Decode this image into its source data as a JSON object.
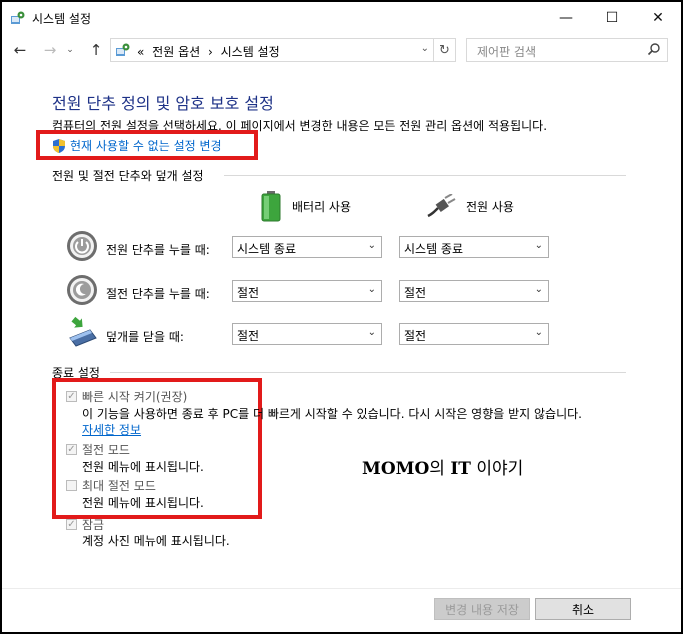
{
  "window": {
    "title": "시스템 설정",
    "icons": {
      "app": "control-panel-icon",
      "minimize": "minimize-icon",
      "maximize": "maximize-icon",
      "close": "close-icon"
    }
  },
  "nav": {
    "breadcrumb_prefix": "«",
    "breadcrumb_1": "전원 옵션",
    "breadcrumb_sep": "›",
    "breadcrumb_2": "시스템 설정",
    "search_placeholder": "제어판 검색"
  },
  "page": {
    "heading": "전원 단추 정의 및 암호 보호 설정",
    "description": "컴퓨터의 전원 설정을 선택하세요. 이 페이지에서 변경한 내용은 모든 전원 관리 옵션에 적용됩니다.",
    "change_link": "현재 사용할 수 없는 설정 변경"
  },
  "buttons_section": {
    "title": "전원 및 절전 단추와 덮개 설정",
    "col_battery": "배터리 사용",
    "col_plugged": "전원 사용",
    "rows": [
      {
        "label": "전원 단추를 누를 때:",
        "battery": "시스템 종료",
        "plugged": "시스템 종료",
        "icon": "power-button-icon"
      },
      {
        "label": "절전 단추를 누를 때:",
        "battery": "절전",
        "plugged": "절전",
        "icon": "sleep-button-icon"
      },
      {
        "label": "덮개를 닫을 때:",
        "battery": "절전",
        "plugged": "절전",
        "icon": "laptop-lid-icon"
      }
    ]
  },
  "shutdown_section": {
    "title": "종료 설정",
    "items": [
      {
        "label": "빠른 시작 켜기(권장)",
        "checked": true,
        "desc": "이 기능을 사용하면 종료 후 PC를 더 빠르게 시작할 수 있습니다. 다시 시작은 영향을 받지 않습니다.",
        "link": "자세한 정보"
      },
      {
        "label": "절전 모드",
        "checked": true,
        "desc": "전원 메뉴에 표시됩니다."
      },
      {
        "label": "최대 절전 모드",
        "checked": false,
        "desc": "전원 메뉴에 표시됩니다."
      },
      {
        "label": "잠금",
        "checked": true,
        "desc": "계정 사진 메뉴에 표시됩니다."
      }
    ]
  },
  "watermark": {
    "brand": "MOMO",
    "mid": "의 ",
    "brand2": "IT",
    "rest": " 이야기"
  },
  "footer": {
    "save": "변경 내용 저장",
    "cancel": "취소"
  },
  "colors": {
    "heading": "#1e3287",
    "link": "#0066cc",
    "highlight": "#e21a1a"
  }
}
